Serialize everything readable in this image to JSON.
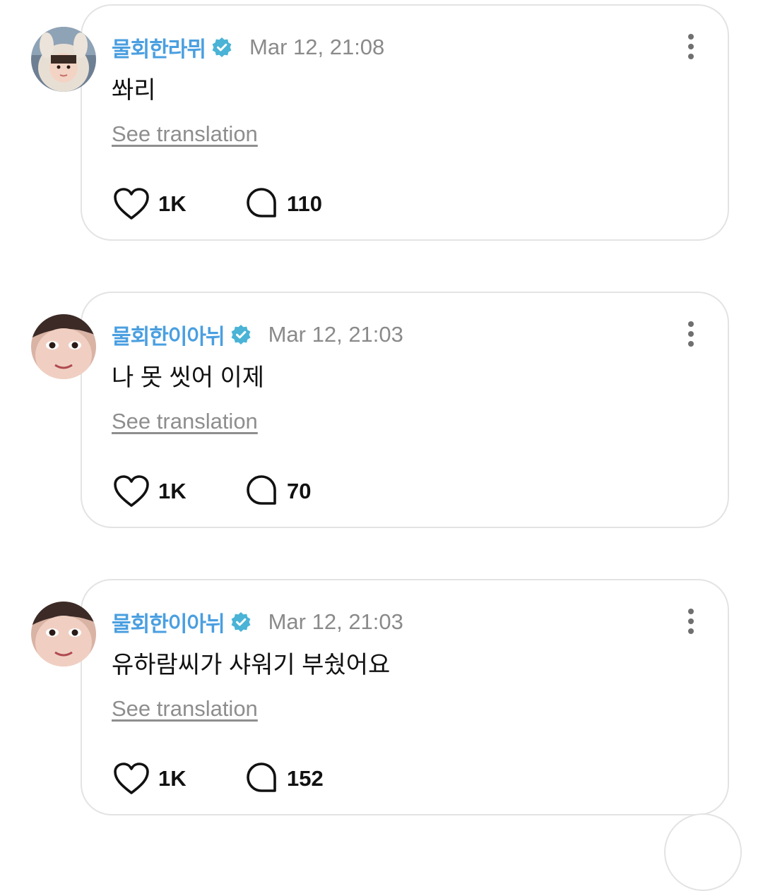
{
  "posts": [
    {
      "username": "물회한라뮈",
      "timestamp": "Mar 12, 21:08",
      "text": "쏴리",
      "translate_label": "See translation",
      "likes": "1K",
      "comments": "110",
      "avatar_icon": "profile-photo-bunny-hood",
      "verified_icon": "verified-badge-icon"
    },
    {
      "username": "물회한이아뉘",
      "timestamp": "Mar 12, 21:03",
      "text": "나 못 씻어 이제",
      "translate_label": "See translation",
      "likes": "1K",
      "comments": "70",
      "avatar_icon": "profile-photo-closeup",
      "verified_icon": "verified-badge-icon"
    },
    {
      "username": "물회한이아뉘",
      "timestamp": "Mar 12, 21:03",
      "text": "유하람씨가 샤워기 부쉈어요",
      "translate_label": "See translation",
      "likes": "1K",
      "comments": "152",
      "avatar_icon": "profile-photo-closeup",
      "verified_icon": "verified-badge-icon"
    }
  ],
  "colors": {
    "username": "#4a9fe0",
    "verified_badge": "#4ab3d6",
    "timestamp": "#8a8a8a",
    "card_border": "#e3e3e3"
  }
}
